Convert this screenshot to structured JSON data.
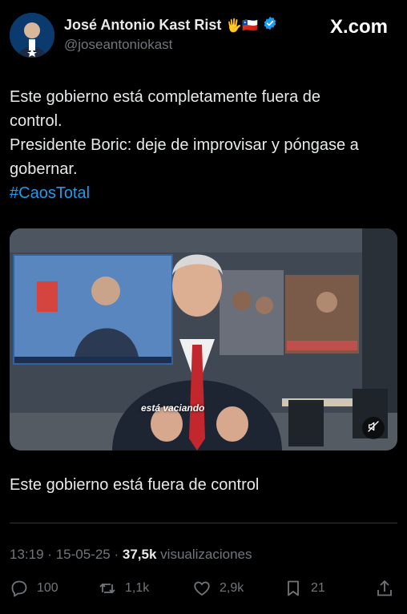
{
  "author": {
    "display_name": "José Antonio Kast Rist",
    "name_emojis": "🖐🇨🇱",
    "handle": "@joseantoniokast",
    "verified": true,
    "verified_color": "#1d9bf0"
  },
  "brand": "X.com",
  "tweet": {
    "lines": [
      "Este gobierno está completamente fuera de",
      "control.",
      "Presidente Boric: deje de improvisar y póngase a",
      "gobernar."
    ],
    "hashtag": "#CaosTotal"
  },
  "video": {
    "subtitle": "está vaciando",
    "muted": true
  },
  "caption": "Este gobierno está fuera de control",
  "meta": {
    "time": "13:19",
    "sep1": "·",
    "date": "15-05-25",
    "sep2": "·",
    "views": "37,5k",
    "views_label": "visualizaciones"
  },
  "actions": {
    "replies": "100",
    "reposts": "1,1k",
    "likes": "2,9k",
    "bookmarks": "21"
  },
  "colors": {
    "background": "#000000",
    "text": "#e7e9ea",
    "muted_text": "#71767b",
    "link": "#1d9bf0"
  }
}
